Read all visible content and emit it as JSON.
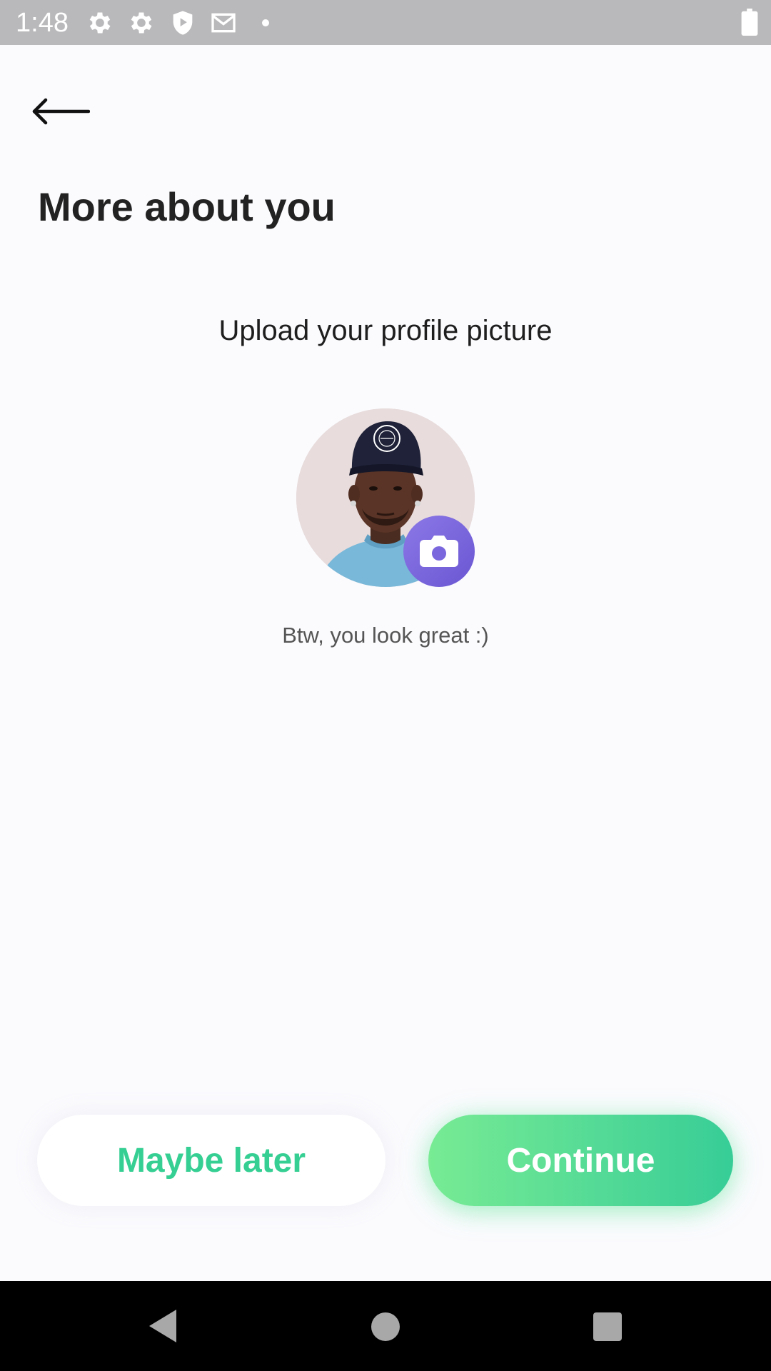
{
  "status_bar": {
    "time": "1:48",
    "icons": [
      "gear-icon",
      "gear-icon",
      "play-protect-icon",
      "gmail-icon",
      "dot-icon",
      "battery-icon"
    ]
  },
  "header": {
    "back_icon": "arrow-left-icon",
    "title": "More about you"
  },
  "profile": {
    "upload_label": "Upload your profile picture",
    "camera_icon": "camera-icon",
    "compliment": "Btw, you look great :)"
  },
  "actions": {
    "maybe_later": "Maybe later",
    "continue": "Continue"
  },
  "colors": {
    "accent_green": "#36cf93",
    "gradient_start": "#78eb94",
    "gradient_end": "#37cd97",
    "camera_purple": "#7a66dd",
    "background": "#fbfbfe"
  },
  "nav_bar": {
    "icons": [
      "nav-back-icon",
      "nav-home-icon",
      "nav-recents-icon"
    ]
  }
}
